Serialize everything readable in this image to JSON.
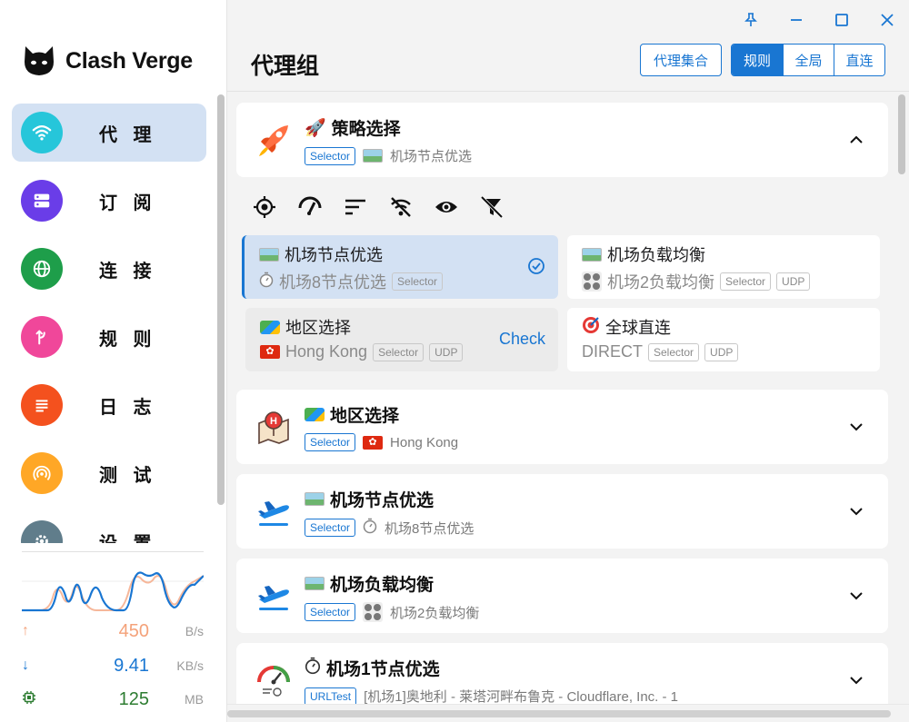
{
  "app": {
    "name": "Clash Verge"
  },
  "window_controls": [
    "pin-icon",
    "minimize-icon",
    "maximize-icon",
    "close-icon"
  ],
  "header": {
    "title": "代理组",
    "provider_button": "代理集合",
    "modes": [
      {
        "label": "规则",
        "active": true
      },
      {
        "label": "全局",
        "active": false
      },
      {
        "label": "直连",
        "active": false
      }
    ]
  },
  "sidebar": {
    "items": [
      {
        "label": "代 理",
        "icon": "wifi-icon",
        "color": "#26c6da",
        "active": true
      },
      {
        "label": "订 阅",
        "icon": "server-icon",
        "color": "#6a3de8",
        "active": false
      },
      {
        "label": "连 接",
        "icon": "globe-icon",
        "color": "#1e9e4a",
        "active": false
      },
      {
        "label": "规 则",
        "icon": "fork-icon",
        "color": "#f0479a",
        "active": false
      },
      {
        "label": "日 志",
        "icon": "log-icon",
        "color": "#f4511e",
        "active": false
      },
      {
        "label": "测 试",
        "icon": "broadcast-icon",
        "color": "#ffa726",
        "active": false
      },
      {
        "label": "设 置",
        "icon": "gear-icon",
        "color": "#607d8b",
        "active": false
      }
    ]
  },
  "traffic": {
    "up_value": "450",
    "up_unit": "B/s",
    "up_color": "#f4a27a",
    "down_value": "9.41",
    "down_unit": "KB/s",
    "down_color": "#1976d2",
    "mem_value": "125",
    "mem_unit": "MB",
    "mem_color": "#2e7d32"
  },
  "groups": {
    "strategy": {
      "emoji": "🚀",
      "title": "策略选择",
      "type": "Selector",
      "current": "机场节点优选",
      "expanded": true
    },
    "toolbar": [
      "locate-icon",
      "speed-test-icon",
      "sort-icon",
      "no-signal-icon",
      "eye-icon",
      "filter-off-icon"
    ],
    "nodes": [
      {
        "name": "机场节点优选",
        "sub": "机场8节点优选",
        "tags": [
          "Selector"
        ],
        "selected": true
      },
      {
        "name": "机场负载均衡",
        "sub": "机场2负载均衡",
        "tags": [
          "Selector",
          "UDP"
        ],
        "selected": false
      },
      {
        "name": "地区选择",
        "sub": "Hong Kong",
        "tags": [
          "Selector",
          "UDP"
        ],
        "action": "Check"
      },
      {
        "name": "全球直连",
        "sub": "DIRECT",
        "tags": [
          "Selector",
          "UDP"
        ]
      }
    ],
    "region": {
      "title": "地区选择",
      "type": "Selector",
      "current": "Hong Kong"
    },
    "airport_best": {
      "title": "机场节点优选",
      "type": "Selector",
      "current": "机场8节点优选"
    },
    "airport_balance": {
      "title": "机场负载均衡",
      "type": "Selector",
      "current": "机场2负载均衡"
    },
    "airport1": {
      "title": "机场1节点优选",
      "type": "URLTest",
      "current": "[机场1]奥地利 - 莱塔河畔布鲁克 - Cloudflare, Inc. - 1"
    }
  }
}
